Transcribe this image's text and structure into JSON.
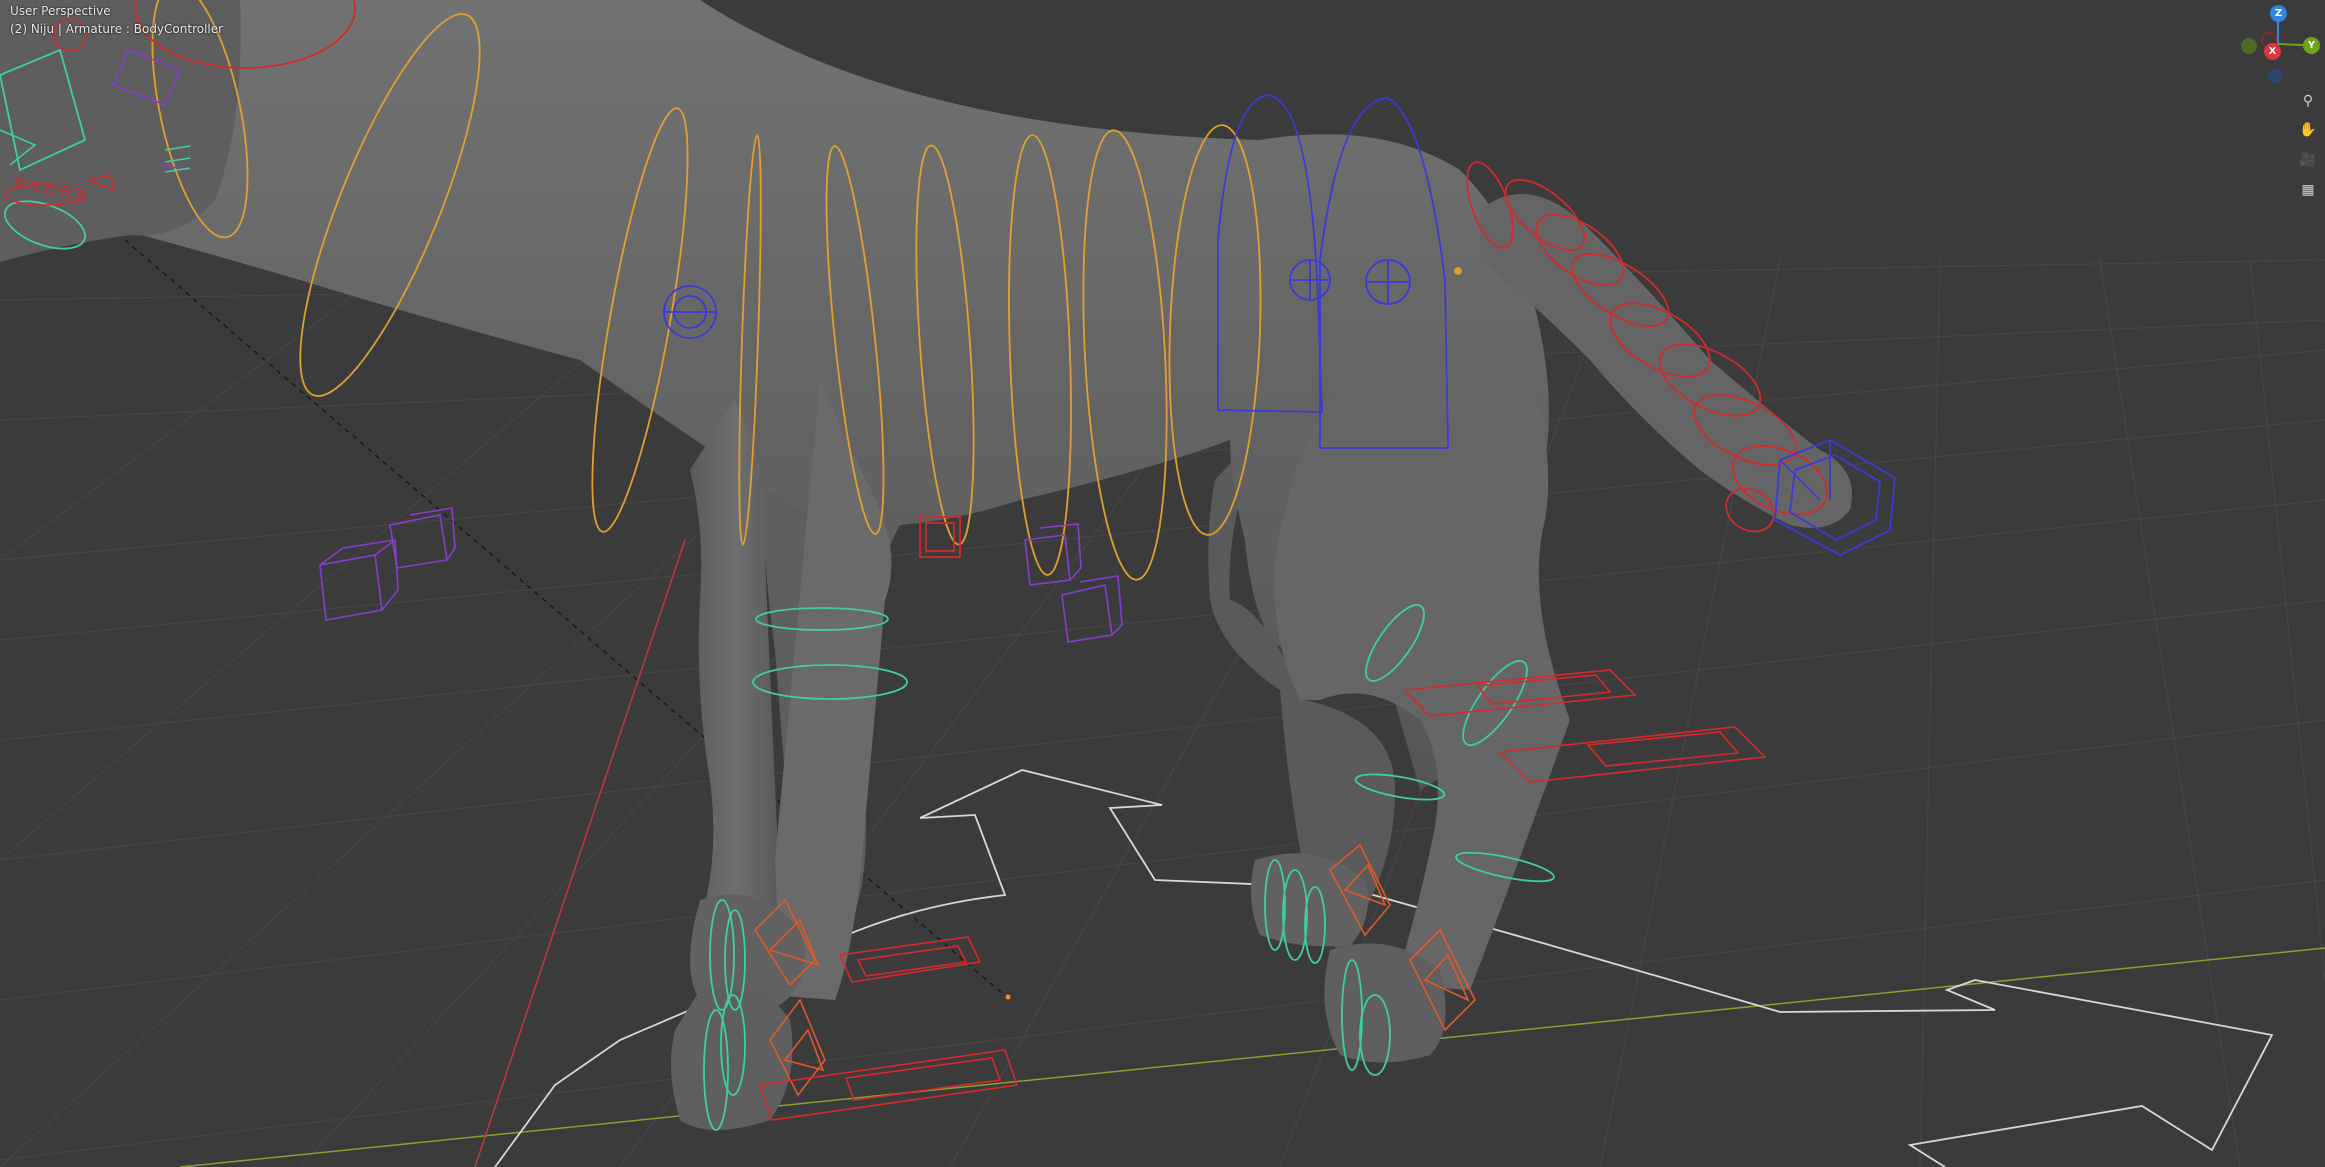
{
  "viewport": {
    "view_name": "User Perspective",
    "object_info": "(2) Niju | Armature : BodyController"
  },
  "navigation_gizmo": {
    "z_label": "Z",
    "y_label": "Y",
    "x_label": "X",
    "colors": {
      "x": "#e0353f",
      "y": "#6ea61a",
      "z": "#2f86e0"
    }
  },
  "nav_buttons": [
    {
      "name": "zoom-icon",
      "glyph": "⚲"
    },
    {
      "name": "pan-hand-icon",
      "glyph": "✋"
    },
    {
      "name": "camera-view-icon",
      "glyph": "🎥"
    },
    {
      "name": "orthographic-grid-icon",
      "glyph": "▦"
    }
  ],
  "colors": {
    "background": "#3b3b3b",
    "grid": "#474747",
    "mesh": "#686868",
    "bone_torso": "#e0a030",
    "bone_tail": "#d02c2c",
    "bone_hips": "#3a3ad8",
    "bone_legs": "#3fcf9a",
    "bone_ik": "#8a3cd0",
    "root_control": "#d8d8d8"
  }
}
